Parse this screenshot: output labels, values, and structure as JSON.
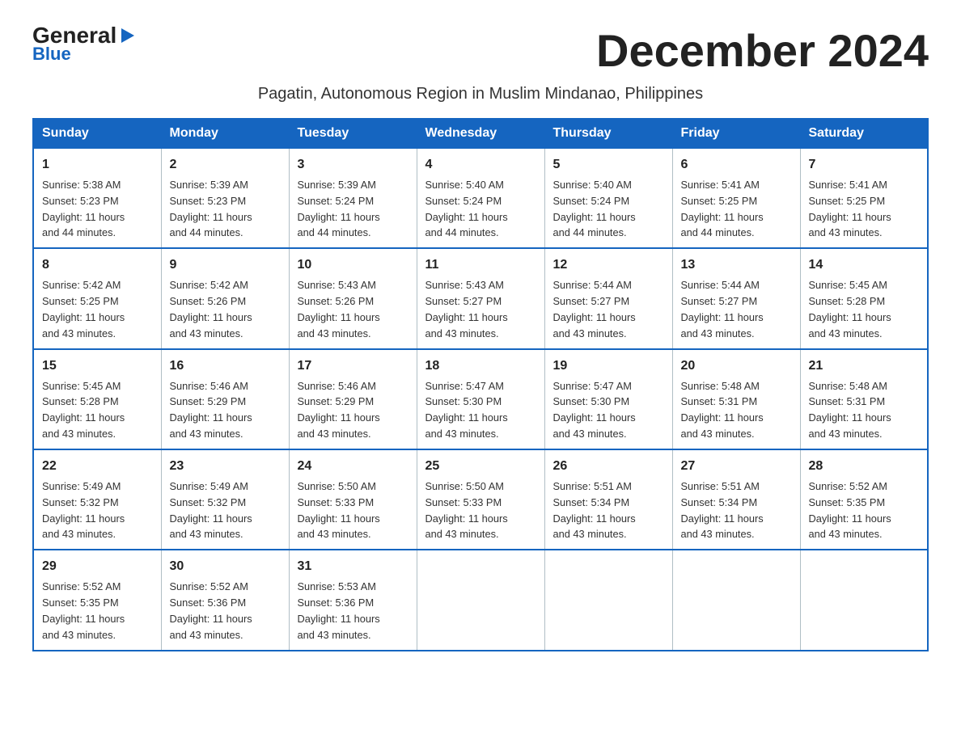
{
  "logo": {
    "general": "General",
    "blue": "Blue",
    "arrow_char": "▶"
  },
  "title": "December 2024",
  "subtitle": "Pagatin, Autonomous Region in Muslim Mindanao, Philippines",
  "headers": [
    "Sunday",
    "Monday",
    "Tuesday",
    "Wednesday",
    "Thursday",
    "Friday",
    "Saturday"
  ],
  "weeks": [
    [
      {
        "day": "1",
        "sunrise": "5:38 AM",
        "sunset": "5:23 PM",
        "daylight": "11 hours and 44 minutes."
      },
      {
        "day": "2",
        "sunrise": "5:39 AM",
        "sunset": "5:23 PM",
        "daylight": "11 hours and 44 minutes."
      },
      {
        "day": "3",
        "sunrise": "5:39 AM",
        "sunset": "5:24 PM",
        "daylight": "11 hours and 44 minutes."
      },
      {
        "day": "4",
        "sunrise": "5:40 AM",
        "sunset": "5:24 PM",
        "daylight": "11 hours and 44 minutes."
      },
      {
        "day": "5",
        "sunrise": "5:40 AM",
        "sunset": "5:24 PM",
        "daylight": "11 hours and 44 minutes."
      },
      {
        "day": "6",
        "sunrise": "5:41 AM",
        "sunset": "5:25 PM",
        "daylight": "11 hours and 44 minutes."
      },
      {
        "day": "7",
        "sunrise": "5:41 AM",
        "sunset": "5:25 PM",
        "daylight": "11 hours and 43 minutes."
      }
    ],
    [
      {
        "day": "8",
        "sunrise": "5:42 AM",
        "sunset": "5:25 PM",
        "daylight": "11 hours and 43 minutes."
      },
      {
        "day": "9",
        "sunrise": "5:42 AM",
        "sunset": "5:26 PM",
        "daylight": "11 hours and 43 minutes."
      },
      {
        "day": "10",
        "sunrise": "5:43 AM",
        "sunset": "5:26 PM",
        "daylight": "11 hours and 43 minutes."
      },
      {
        "day": "11",
        "sunrise": "5:43 AM",
        "sunset": "5:27 PM",
        "daylight": "11 hours and 43 minutes."
      },
      {
        "day": "12",
        "sunrise": "5:44 AM",
        "sunset": "5:27 PM",
        "daylight": "11 hours and 43 minutes."
      },
      {
        "day": "13",
        "sunrise": "5:44 AM",
        "sunset": "5:27 PM",
        "daylight": "11 hours and 43 minutes."
      },
      {
        "day": "14",
        "sunrise": "5:45 AM",
        "sunset": "5:28 PM",
        "daylight": "11 hours and 43 minutes."
      }
    ],
    [
      {
        "day": "15",
        "sunrise": "5:45 AM",
        "sunset": "5:28 PM",
        "daylight": "11 hours and 43 minutes."
      },
      {
        "day": "16",
        "sunrise": "5:46 AM",
        "sunset": "5:29 PM",
        "daylight": "11 hours and 43 minutes."
      },
      {
        "day": "17",
        "sunrise": "5:46 AM",
        "sunset": "5:29 PM",
        "daylight": "11 hours and 43 minutes."
      },
      {
        "day": "18",
        "sunrise": "5:47 AM",
        "sunset": "5:30 PM",
        "daylight": "11 hours and 43 minutes."
      },
      {
        "day": "19",
        "sunrise": "5:47 AM",
        "sunset": "5:30 PM",
        "daylight": "11 hours and 43 minutes."
      },
      {
        "day": "20",
        "sunrise": "5:48 AM",
        "sunset": "5:31 PM",
        "daylight": "11 hours and 43 minutes."
      },
      {
        "day": "21",
        "sunrise": "5:48 AM",
        "sunset": "5:31 PM",
        "daylight": "11 hours and 43 minutes."
      }
    ],
    [
      {
        "day": "22",
        "sunrise": "5:49 AM",
        "sunset": "5:32 PM",
        "daylight": "11 hours and 43 minutes."
      },
      {
        "day": "23",
        "sunrise": "5:49 AM",
        "sunset": "5:32 PM",
        "daylight": "11 hours and 43 minutes."
      },
      {
        "day": "24",
        "sunrise": "5:50 AM",
        "sunset": "5:33 PM",
        "daylight": "11 hours and 43 minutes."
      },
      {
        "day": "25",
        "sunrise": "5:50 AM",
        "sunset": "5:33 PM",
        "daylight": "11 hours and 43 minutes."
      },
      {
        "day": "26",
        "sunrise": "5:51 AM",
        "sunset": "5:34 PM",
        "daylight": "11 hours and 43 minutes."
      },
      {
        "day": "27",
        "sunrise": "5:51 AM",
        "sunset": "5:34 PM",
        "daylight": "11 hours and 43 minutes."
      },
      {
        "day": "28",
        "sunrise": "5:52 AM",
        "sunset": "5:35 PM",
        "daylight": "11 hours and 43 minutes."
      }
    ],
    [
      {
        "day": "29",
        "sunrise": "5:52 AM",
        "sunset": "5:35 PM",
        "daylight": "11 hours and 43 minutes."
      },
      {
        "day": "30",
        "sunrise": "5:52 AM",
        "sunset": "5:36 PM",
        "daylight": "11 hours and 43 minutes."
      },
      {
        "day": "31",
        "sunrise": "5:53 AM",
        "sunset": "5:36 PM",
        "daylight": "11 hours and 43 minutes."
      },
      null,
      null,
      null,
      null
    ]
  ],
  "labels": {
    "sunrise": "Sunrise:",
    "sunset": "Sunset:",
    "daylight": "Daylight:"
  }
}
